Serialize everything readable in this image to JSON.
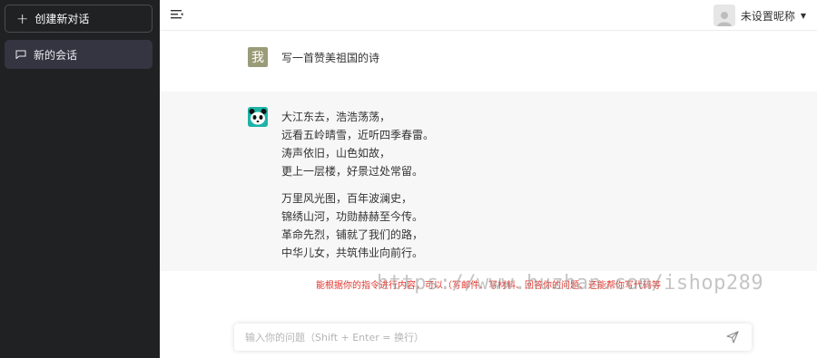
{
  "sidebar": {
    "new_chat_label": "创建新对话",
    "conversations": [
      {
        "label": "新的会话"
      }
    ]
  },
  "header": {
    "nickname": "未设置昵称"
  },
  "messages": {
    "user": {
      "avatar_text": "我",
      "text": "写一首赞美祖国的诗"
    },
    "bot": {
      "stanza1": [
        "大江东去，浩浩荡荡，",
        "远看五岭晴雪，近听四季春雷。",
        "涛声依旧，山色如故，",
        "更上一层楼，好景过处常留。"
      ],
      "stanza2": [
        "万里风光图，百年波澜史，",
        "锦绣山河，功勋赫赫至今传。",
        "革命先烈，铺就了我们的路，",
        "中华儿女，共筑伟业向前行。"
      ]
    }
  },
  "notice": "能根据你的指令进行内容，可以（写邮件、写材料、回答你的问题、还能帮你写代码等",
  "input": {
    "placeholder": "输入你的问题（Shift + Enter = 换行）"
  },
  "watermark": "https://www.huzhan.com/ishop289",
  "colors": {
    "sidebar_bg": "#202123",
    "active_item": "#343541",
    "bot_bg": "#f7f7f8",
    "notice": "#e0342c"
  }
}
